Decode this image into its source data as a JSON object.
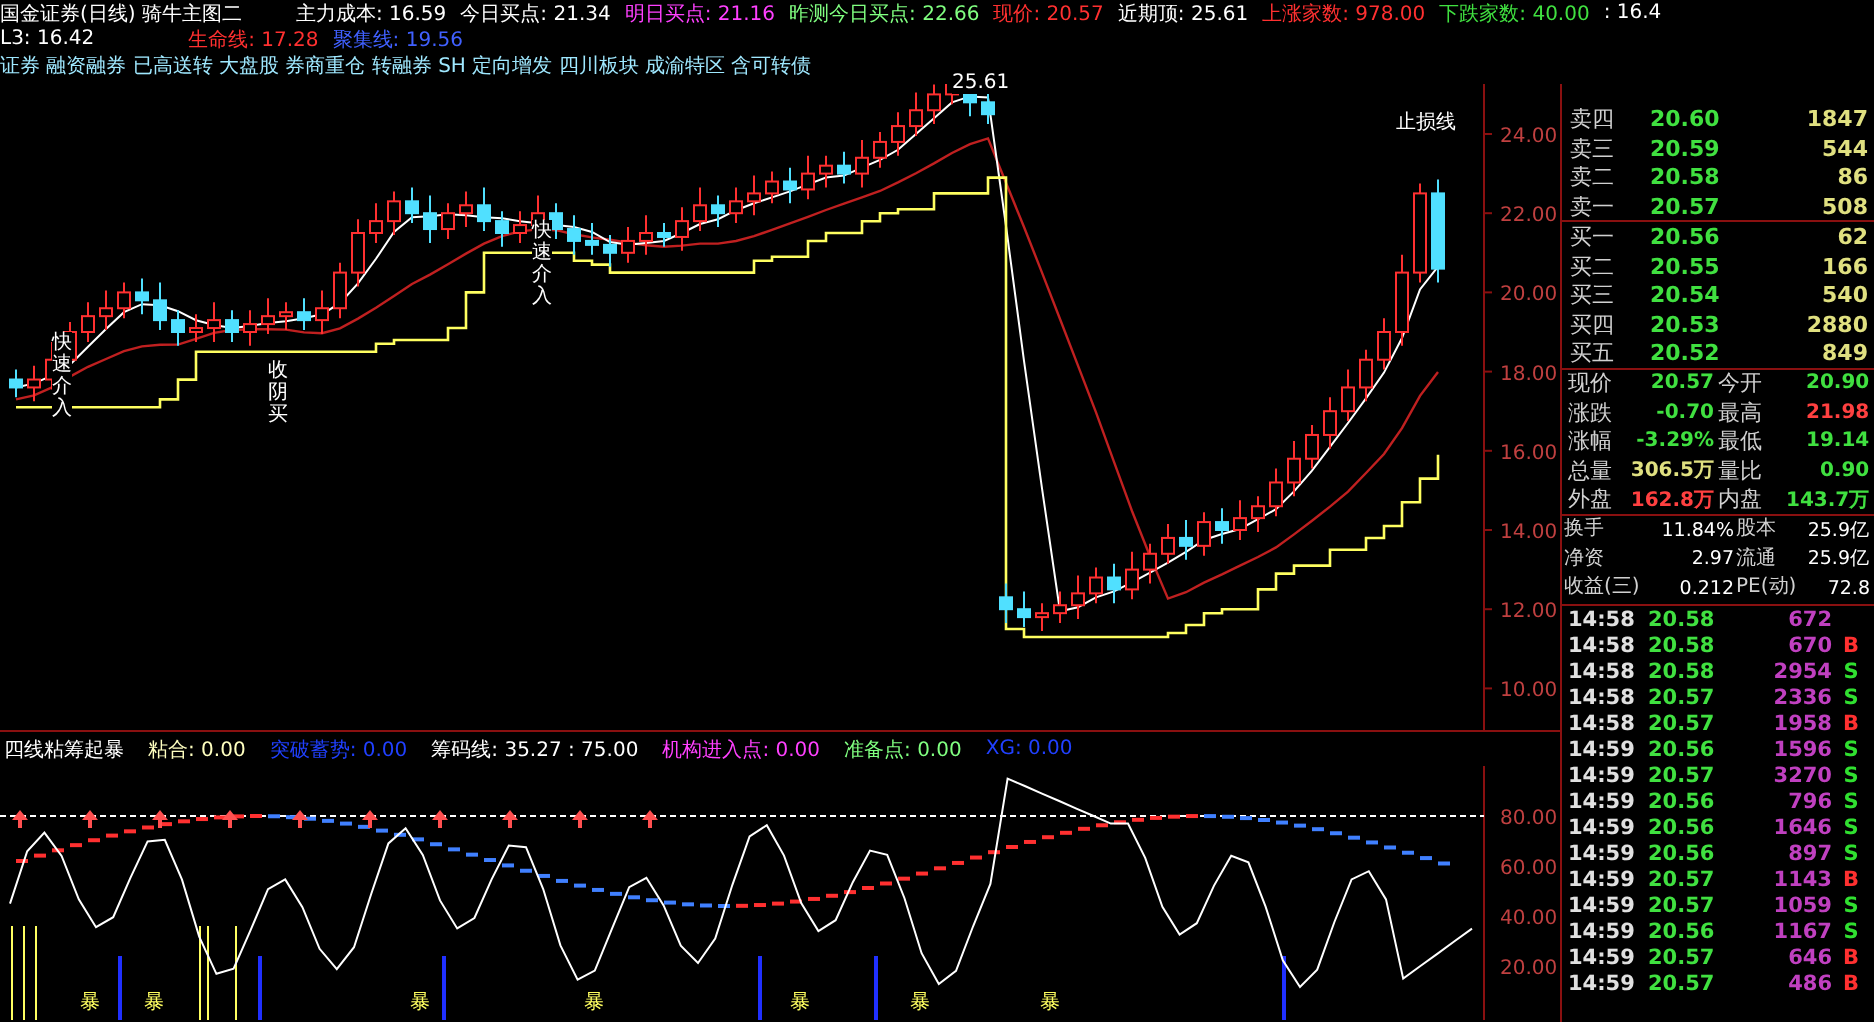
{
  "header": {
    "title": "国金证券(日线) 骑牛主图二",
    "line1": [
      {
        "text": "主力成本: 16.59",
        "color": "#ffffff"
      },
      {
        "text": "今日买点: 21.34",
        "color": "#ffffff"
      },
      {
        "text": "明日买点: 21.16",
        "color": "#ff40ff"
      },
      {
        "text": "昨测今日买点: 22.66",
        "color": "#80ff80"
      },
      {
        "text": "现价: 20.57",
        "color": "#ff3030"
      },
      {
        "text": "近期顶: 25.61",
        "color": "#ffffff"
      },
      {
        "text": "上涨家数: 978.00",
        "color": "#ff3030"
      },
      {
        "text": "下跌家数: 40.00",
        "color": "#40e040"
      },
      {
        "text": ": 16.4",
        "color": "#ffffff"
      }
    ],
    "line2": [
      {
        "text": "L3: 16.42",
        "color": "#ffffff"
      },
      {
        "text": "生命线: 17.28",
        "color": "#ff3030"
      },
      {
        "text": "聚集线: 19.56",
        "color": "#4060ff"
      }
    ],
    "concepts": "证券 融资融券 已高送转 大盘股 券商重仓 转融券 SH 定向增发 四川板块 成渝特区 含可转债"
  },
  "main_chart": {
    "price_axis": [
      "24.00",
      "22.00",
      "20.00",
      "18.00",
      "16.00",
      "14.00",
      "12.00",
      "10.00"
    ],
    "annotations": [
      {
        "text": "25.61",
        "kind": "horizontal"
      },
      {
        "text": "快速介入",
        "kind": "vertical"
      },
      {
        "text": "收阴买",
        "kind": "vertical"
      },
      {
        "text": "快速介入",
        "kind": "vertical"
      },
      {
        "text": "止损线",
        "kind": "horizontal"
      }
    ]
  },
  "indicator": {
    "items": [
      {
        "text": "四线粘筹起暴",
        "color": "#ffffff"
      },
      {
        "text": "粘合: 0.00",
        "color": "#ffffc0"
      },
      {
        "text": "突破蓄势: 0.00",
        "color": "#2040ff"
      },
      {
        "text": "筹码线: 35.27 : 75.00",
        "color": "#ffffff"
      },
      {
        "text": "机构进入点: 0.00",
        "color": "#ff40ff"
      },
      {
        "text": "准备点: 0.00",
        "color": "#80ff80"
      },
      {
        "text": "XG: 0.00",
        "color": "#2040ff"
      }
    ],
    "axis": [
      "80.00",
      "60.00",
      "40.00",
      "20.00"
    ],
    "signals": [
      "暴",
      "暴",
      "暴",
      "暴",
      "暴",
      "暴",
      "暴"
    ]
  },
  "asks": [
    {
      "label": "卖四",
      "price": "20.60",
      "volume": "1847"
    },
    {
      "label": "卖三",
      "price": "20.59",
      "volume": "544"
    },
    {
      "label": "卖二",
      "price": "20.58",
      "volume": "86"
    },
    {
      "label": "卖一",
      "price": "20.57",
      "volume": "508"
    }
  ],
  "bids": [
    {
      "label": "买一",
      "price": "20.56",
      "volume": "62"
    },
    {
      "label": "买二",
      "price": "20.55",
      "volume": "166"
    },
    {
      "label": "买三",
      "price": "20.54",
      "volume": "540"
    },
    {
      "label": "买四",
      "price": "20.53",
      "volume": "2880"
    },
    {
      "label": "买五",
      "price": "20.52",
      "volume": "849"
    }
  ],
  "quote": [
    {
      "label": "现价",
      "value": "20.57",
      "color": "#40e040"
    },
    {
      "label": "今开",
      "value": "20.90",
      "color": "#40e040"
    },
    {
      "label": "涨跌",
      "value": "-0.70",
      "color": "#40e040"
    },
    {
      "label": "最高",
      "value": "21.98",
      "color": "#ff4040"
    },
    {
      "label": "涨幅",
      "value": "-3.29%",
      "color": "#40e040"
    },
    {
      "label": "最低",
      "value": "19.14",
      "color": "#40e040"
    },
    {
      "label": "总量",
      "value": "306.5万",
      "color": "#e0e080"
    },
    {
      "label": "量比",
      "value": "0.90",
      "color": "#40e040"
    },
    {
      "label": "外盘",
      "value": "162.8万",
      "color": "#ff4040"
    },
    {
      "label": "内盘",
      "value": "143.7万",
      "color": "#40e040"
    }
  ],
  "fundamentals": [
    {
      "label": "换手",
      "value": "11.84%"
    },
    {
      "label": "股本",
      "value": "25.9亿"
    },
    {
      "label": "净资",
      "value": "2.97"
    },
    {
      "label": "流通",
      "value": "25.9亿"
    },
    {
      "label": "收益(三)",
      "value": "0.212"
    },
    {
      "label": "PE(动)",
      "value": "72.8"
    }
  ],
  "ticks": [
    {
      "time": "14:58",
      "price": "20.58",
      "volume": "672"
    },
    {
      "time": "14:58",
      "price": "20.58",
      "volume": "670",
      "side": "B",
      "kind": "buy"
    },
    {
      "time": "14:58",
      "price": "20.58",
      "volume": "2954",
      "side": "S",
      "kind": "sell"
    },
    {
      "time": "14:58",
      "price": "20.57",
      "volume": "2336",
      "side": "S",
      "kind": "sell"
    },
    {
      "time": "14:58",
      "price": "20.57",
      "volume": "1958",
      "side": "B",
      "kind": "buy"
    },
    {
      "time": "14:59",
      "price": "20.56",
      "volume": "1596",
      "side": "S",
      "kind": "sell"
    },
    {
      "time": "14:59",
      "price": "20.57",
      "volume": "3270",
      "side": "S",
      "kind": "sell"
    },
    {
      "time": "14:59",
      "price": "20.56",
      "volume": "796",
      "side": "S",
      "kind": "sell"
    },
    {
      "time": "14:59",
      "price": "20.56",
      "volume": "1646",
      "side": "S",
      "kind": "sell"
    },
    {
      "time": "14:59",
      "price": "20.56",
      "volume": "897",
      "side": "S",
      "kind": "sell"
    },
    {
      "time": "14:59",
      "price": "20.57",
      "volume": "1143",
      "side": "B",
      "kind": "buy"
    },
    {
      "time": "14:59",
      "price": "20.57",
      "volume": "1059",
      "side": "S",
      "kind": "sell"
    },
    {
      "time": "14:59",
      "price": "20.56",
      "volume": "1167",
      "side": "S",
      "kind": "sell"
    },
    {
      "time": "14:59",
      "price": "20.57",
      "volume": "646",
      "side": "B",
      "kind": "buy"
    },
    {
      "time": "14:59",
      "price": "20.57",
      "volume": "486",
      "side": "B",
      "kind": "buy"
    }
  ]
}
